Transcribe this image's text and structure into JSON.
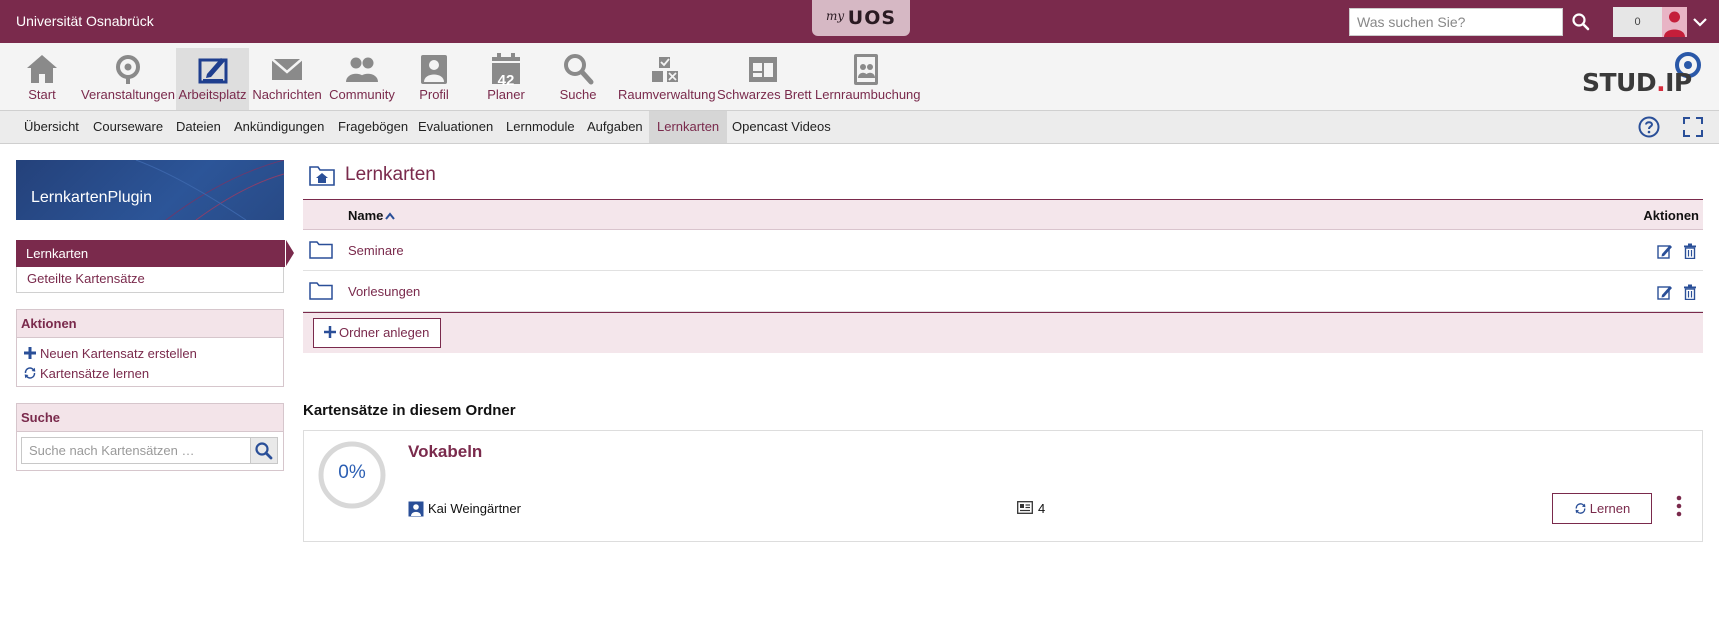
{
  "topbar": {
    "university": "Universität Osnabrück",
    "logo_my": "my",
    "logo_uos": "UOS",
    "search_placeholder": "Was suchen Sie?",
    "notification_count": "0"
  },
  "main_nav": {
    "items": [
      {
        "label": "Start",
        "icon": "home-icon"
      },
      {
        "label": "Veranstaltungen",
        "icon": "seminar-icon"
      },
      {
        "label": "Arbeitsplatz",
        "icon": "workplace-icon",
        "active": true
      },
      {
        "label": "Nachrichten",
        "icon": "mail-icon"
      },
      {
        "label": "Community",
        "icon": "community-icon"
      },
      {
        "label": "Profil",
        "icon": "profile-icon"
      },
      {
        "label": "Planer",
        "icon": "calendar-icon",
        "calendar_day": "42"
      },
      {
        "label": "Suche",
        "icon": "search-icon"
      },
      {
        "label": "Raumverwaltung",
        "icon": "room-icon"
      },
      {
        "label": "Schwarzes Brett",
        "icon": "board-icon"
      },
      {
        "label": "Lernraumbuchung",
        "icon": "booking-icon"
      }
    ],
    "brand_prefix": "STUD",
    "brand_dot": ".",
    "brand_suffix": "IP"
  },
  "sub_nav": {
    "items": [
      {
        "label": "Übersicht"
      },
      {
        "label": "Courseware"
      },
      {
        "label": "Dateien"
      },
      {
        "label": "Ankündigungen"
      },
      {
        "label": "Fragebögen"
      },
      {
        "label": "Evaluationen"
      },
      {
        "label": "Lernmodule"
      },
      {
        "label": "Aufgaben"
      },
      {
        "label": "Lernkarten",
        "active": true
      },
      {
        "label": "Opencast Videos"
      }
    ]
  },
  "sidebar": {
    "header": "LernkartenPlugin",
    "nav": {
      "active": "Lernkarten",
      "second": "Geteilte Kartensätze"
    },
    "actions": {
      "title": "Aktionen",
      "create": "Neuen Kartensatz erstellen",
      "learn": "Kartensätze lernen"
    },
    "search": {
      "title": "Suche",
      "placeholder": "Suche nach Kartensätzen …"
    }
  },
  "content": {
    "title": "Lernkarten",
    "table": {
      "col_name": "Name",
      "col_actions": "Aktionen",
      "rows": [
        {
          "name": "Seminare"
        },
        {
          "name": "Vorlesungen"
        }
      ],
      "create_folder": "Ordner anlegen"
    },
    "section_title": "Kartensätze in diesem Ordner",
    "card": {
      "progress": "0%",
      "title": "Vokabeln",
      "author": "Kai Weingärtner",
      "card_count": "4",
      "learn_button": "Lernen"
    }
  },
  "colors": {
    "brand": "#7a2a4c",
    "accent_blue": "#2c5fb3"
  }
}
